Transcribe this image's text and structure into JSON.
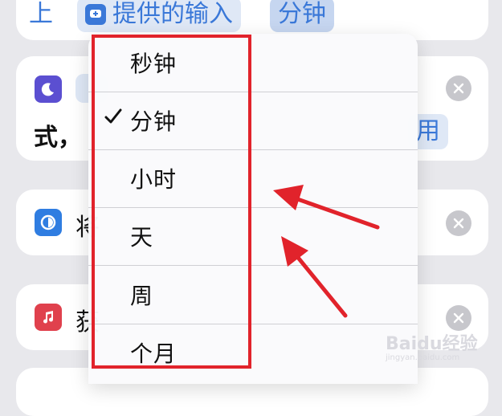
{
  "top_bar": {
    "left_char": "上",
    "input_label": "提供的输入",
    "unit_label": "分钟"
  },
  "rows": [
    {
      "text_left": "式，",
      "text_right": "用"
    },
    {
      "text_left": "将"
    },
    {
      "text_left": "获"
    }
  ],
  "menu": {
    "items": [
      {
        "label": "秒钟",
        "checked": false
      },
      {
        "label": "分钟",
        "checked": true
      },
      {
        "label": "小时",
        "checked": false
      },
      {
        "label": "天",
        "checked": false
      },
      {
        "label": "周",
        "checked": false
      },
      {
        "label": "个月",
        "checked": false
      }
    ]
  },
  "colors": {
    "accent": "#3a78d8",
    "highlight": "#e1232b",
    "moon_icon_bg": "#5b4fd1",
    "focus_icon_bg": "#2f7de1",
    "music_icon_bg": "#e0414d"
  },
  "watermark": {
    "text": "Baidu经验",
    "sub": "jingyan.baidu.com"
  }
}
